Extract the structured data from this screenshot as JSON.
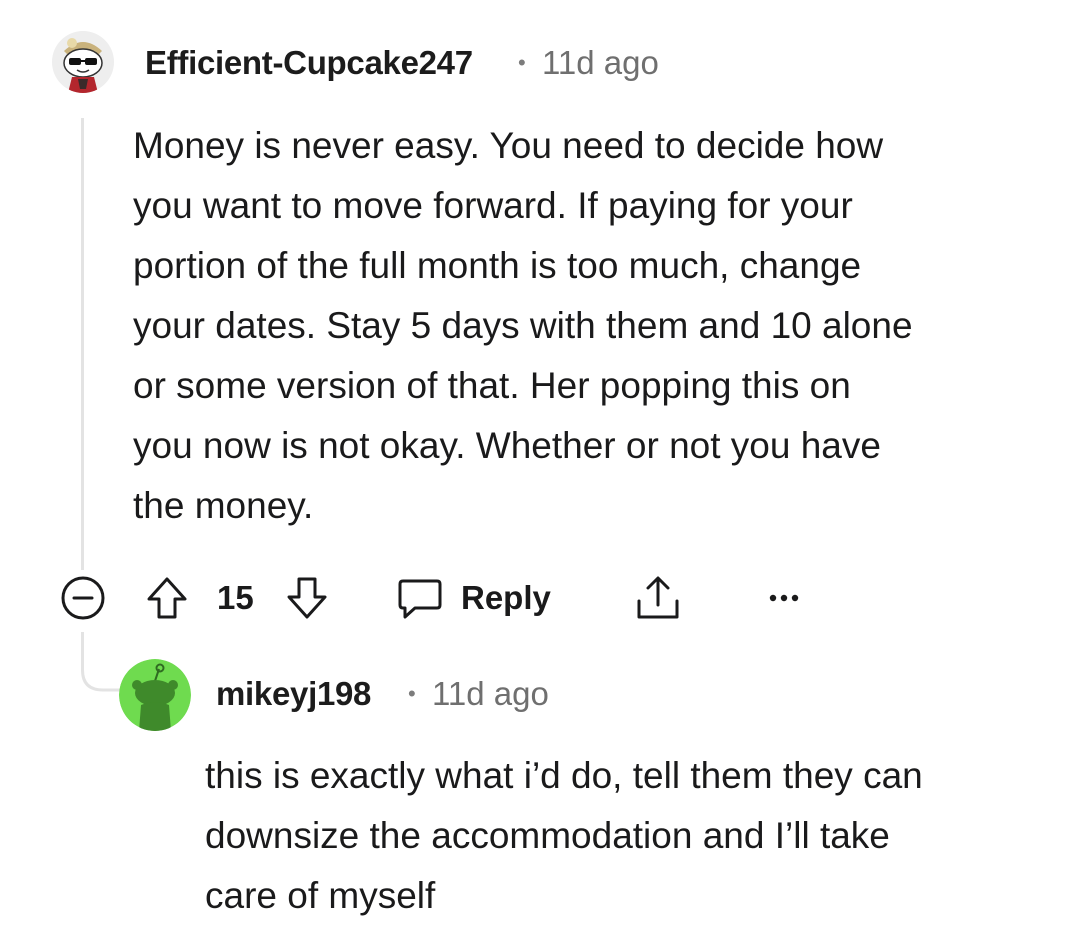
{
  "comment": {
    "author": "Efficient-Cupcake247",
    "separator": "•",
    "time": "11d ago",
    "body_lines": [
      "Money is never easy. You need to decide how",
      "you want to move forward. If paying for your",
      "portion of the full month is too much, change",
      "your dates. Stay 5 days with them and 10 alone",
      "or some version of that. Her popping this on",
      "you now is not okay. Whether or not you have",
      "the money."
    ],
    "actions": {
      "upvote_icon": "arrow-up-icon",
      "score": "15",
      "downvote_icon": "arrow-down-icon",
      "reply_icon": "chat-bubble-icon",
      "reply_label": "Reply",
      "share_icon": "share-icon",
      "more_icon": "more-icon",
      "collapse_icon": "minus-circle-icon"
    }
  },
  "reply": {
    "author": "mikeyj198",
    "separator": "•",
    "time": "11d ago",
    "body_lines": [
      "this is exactly what i’d do, tell them they can",
      "downsize the accommodation and I’ll take",
      "care of myself"
    ],
    "avatar_color": "#6fdb4f"
  }
}
